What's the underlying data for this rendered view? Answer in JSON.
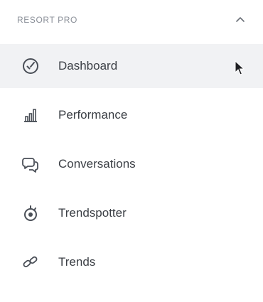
{
  "section": {
    "title": "RESORT PRO",
    "toggle_icon": "chevron-up-icon"
  },
  "nav": {
    "items": [
      {
        "label": "Dashboard",
        "icon": "speedometer-icon",
        "active": true
      },
      {
        "label": "Performance",
        "icon": "bar-chart-icon",
        "active": false
      },
      {
        "label": "Conversations",
        "icon": "chat-bubbles-icon",
        "active": false
      },
      {
        "label": "Trendspotter",
        "icon": "trendspotter-icon",
        "active": false
      },
      {
        "label": "Trends",
        "icon": "trends-link-icon",
        "active": false
      }
    ]
  },
  "colors": {
    "active_background": "#f1f2f4",
    "text": "#3b3f45",
    "muted": "#8a8f98",
    "icon": "#4a4f57"
  }
}
